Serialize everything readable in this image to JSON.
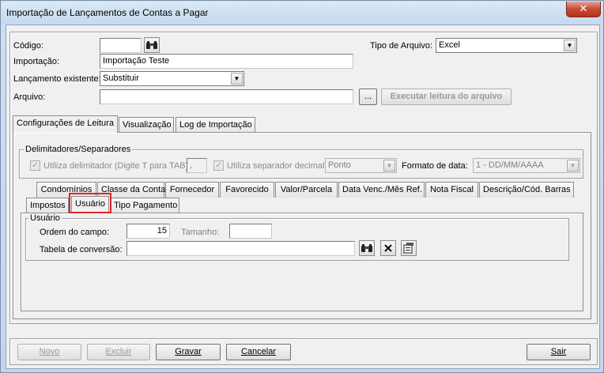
{
  "window": {
    "title": "Importação de Lançamentos de Contas a Pagar",
    "close_label": "✕"
  },
  "form": {
    "codigo_label": "Código:",
    "codigo_value": "",
    "tipo_arquivo_label": "Tipo de Arquivo:",
    "tipo_arquivo_value": "Excel",
    "importacao_label": "Importação:",
    "importacao_value": "Importação Teste",
    "lancamento_label": "Lançamento existente:",
    "lancamento_value": "Substituir",
    "arquivo_label": "Arquivo:",
    "arquivo_value": "",
    "browse_label": "...",
    "executar_label": "Executar leitura do arquivo"
  },
  "main_tabs": [
    {
      "label": "Configurações de Leitura"
    },
    {
      "label": "Visualização"
    },
    {
      "label": "Log de Importação"
    }
  ],
  "delimiters": {
    "legend": "Delimitadores/Separadores",
    "utiliza_delim_label": "Utiliza delimitador (Digite T para TAB)",
    "delim_value": ",",
    "utiliza_sep_label": "Utiliza separador decimal",
    "sep_value": "Ponto",
    "formato_label": "Formato de data:",
    "formato_value": "1 - DD/MM/AAAA"
  },
  "sub_tabs_row1": [
    {
      "label": "Condomínios"
    },
    {
      "label": "Classe da Conta"
    },
    {
      "label": "Fornecedor"
    },
    {
      "label": "Favorecido"
    },
    {
      "label": "Valor/Parcela"
    },
    {
      "label": "Data Venc./Mês Ref."
    },
    {
      "label": "Nota Fiscal"
    },
    {
      "label": "Descrição/Cód. Barras"
    }
  ],
  "sub_tabs_row2": [
    {
      "label": "Impostos"
    },
    {
      "label": "Usuário"
    },
    {
      "label": "Tipo Pagamento"
    }
  ],
  "usuario": {
    "legend": "Usuário",
    "ordem_label": "Ordem do campo:",
    "ordem_value": "15",
    "tamanho_label": "Tamanho:",
    "tamanho_value": "",
    "tabela_label": "Tabela de conversão:",
    "tabela_value": ""
  },
  "footer": {
    "novo": "Novo",
    "excluir": "Excluir",
    "gravar": "Gravar",
    "cancelar": "Cancelar",
    "sair": "Sair"
  },
  "colors": {
    "highlight": "#e02424"
  }
}
